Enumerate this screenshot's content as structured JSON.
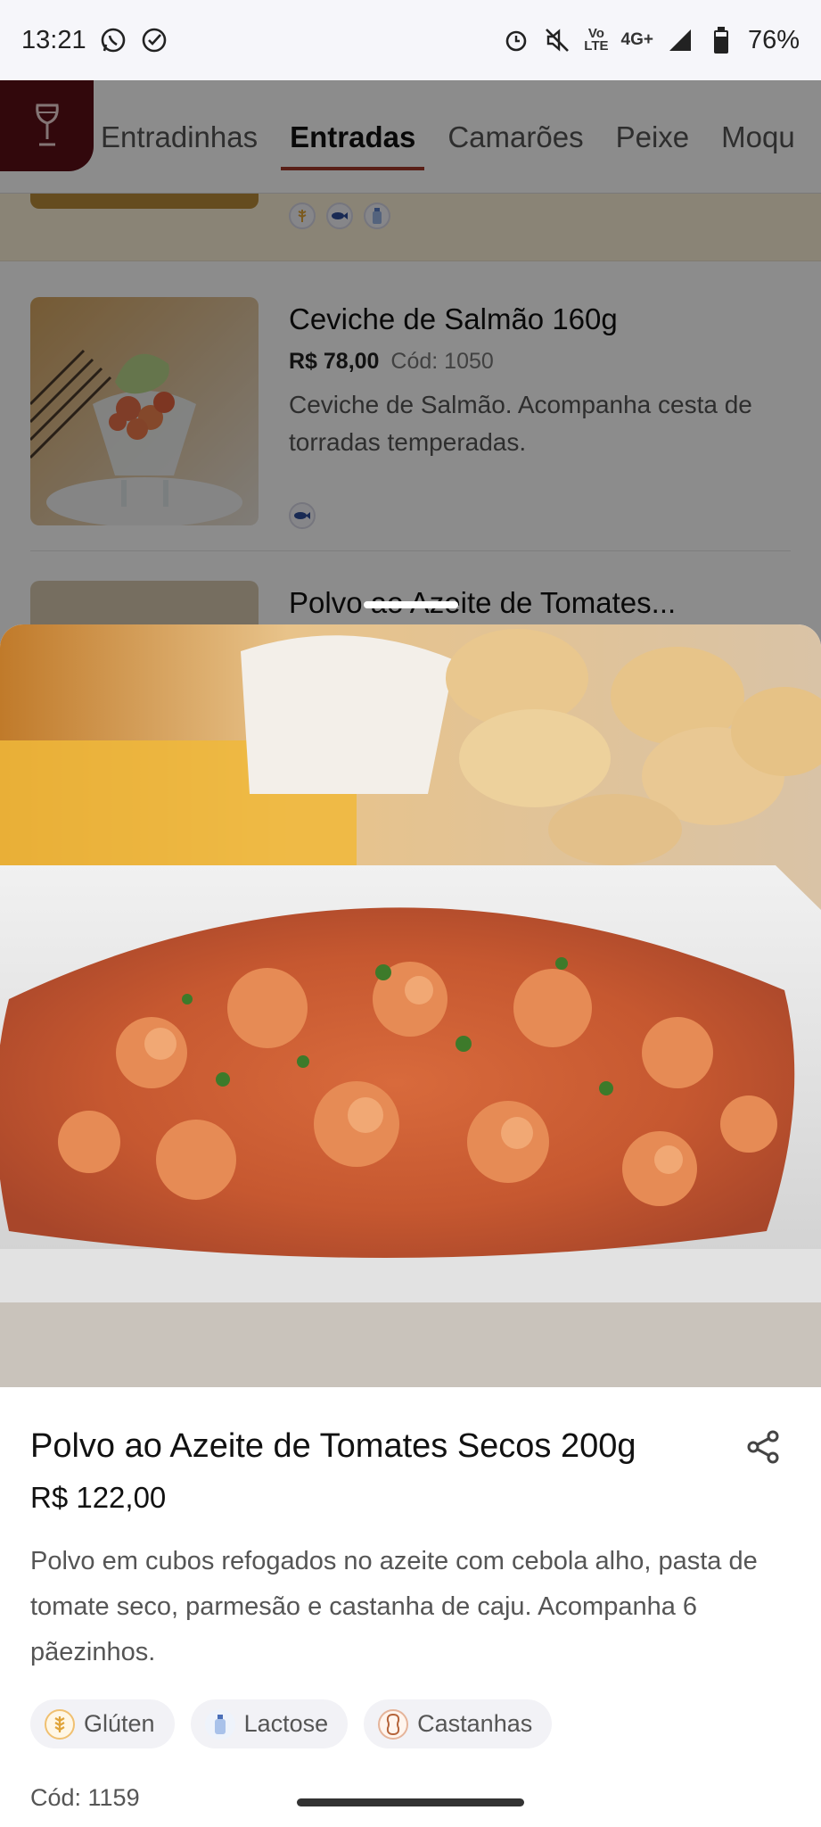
{
  "status_bar": {
    "time": "13:21",
    "battery": "76%",
    "network_top": "Vo",
    "network_mid": "LTE",
    "network_type": "4G+",
    "icons": [
      "whatsapp-icon",
      "check-circle-icon",
      "alarm-icon",
      "mute-icon",
      "signal-icon",
      "battery-icon"
    ]
  },
  "tabs": {
    "items": [
      "Entradinhas",
      "Entradas",
      "Camarões",
      "Peixe",
      "Moqu"
    ],
    "active": "Entradas"
  },
  "list": {
    "items": [
      {
        "title": "Ceviche de Salmão 160g",
        "price": "R$ 78,00",
        "code": "Cód: 1050",
        "description": "Ceviche de Salmão. Acompanha cesta de torradas temperadas."
      },
      {
        "title": "Polvo ao Azeite de Tomates..."
      }
    ]
  },
  "sheet": {
    "title": "Polvo ao Azeite de Tomates Secos 200g",
    "price": "R$ 122,00",
    "description": "Polvo em cubos refogados no azeite com cebola alho, pasta de tomate seco, parmesão e castanha de caju. Acompanha 6 pãezinhos.",
    "allergens": [
      "Glúten",
      "Lactose",
      "Castanhas"
    ],
    "code": "Cód: 1159"
  },
  "colors": {
    "brand": "#5b0f16",
    "tab_underline": "#a23a2a",
    "dim_overlay": "rgba(0,0,0,0.45)",
    "highlight_row": "#fcf1d8"
  }
}
